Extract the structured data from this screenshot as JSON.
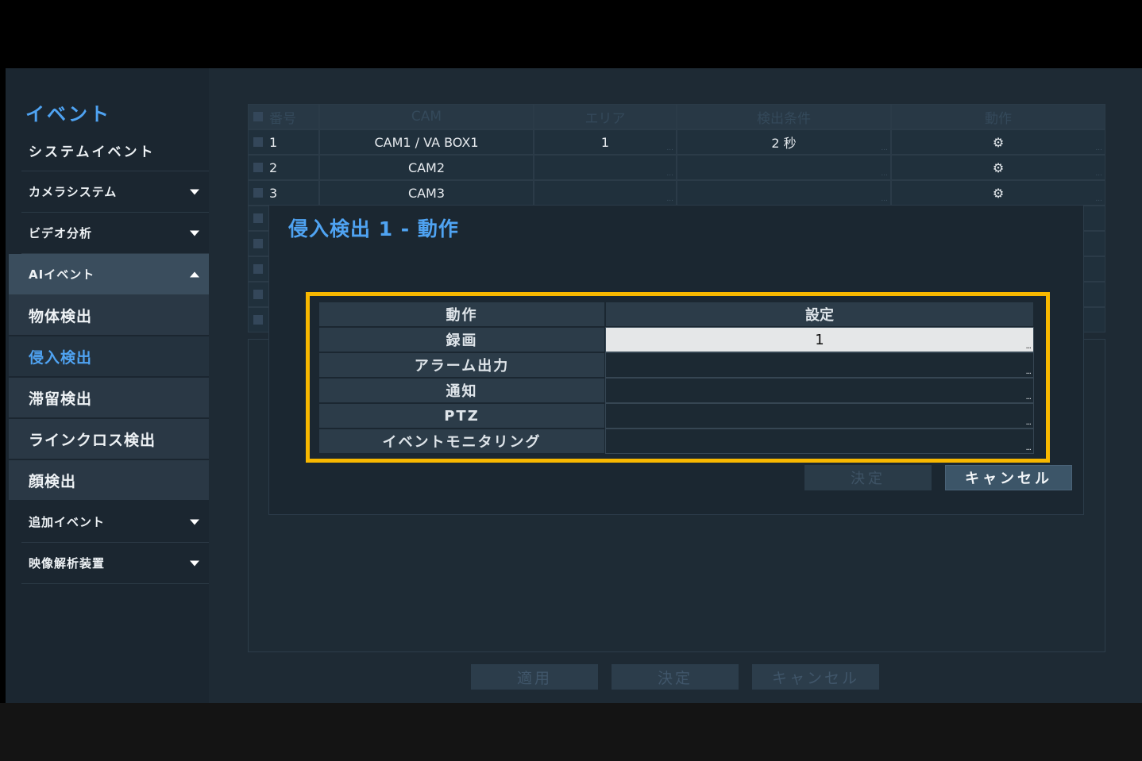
{
  "sidebar": {
    "title": "イベント",
    "items": [
      {
        "label": "システムイベント"
      },
      {
        "label": "カメラシステム"
      },
      {
        "label": "ビデオ分析"
      },
      {
        "label": "AIイベント"
      },
      {
        "label": "物体検出"
      },
      {
        "label": "侵入検出"
      },
      {
        "label": "滞留検出"
      },
      {
        "label": "ラインクロス検出"
      },
      {
        "label": "顔検出"
      },
      {
        "label": "追加イベント"
      },
      {
        "label": "映像解析装置"
      }
    ]
  },
  "background_table": {
    "headers": [
      "番号",
      "CAM",
      "エリア",
      "検出条件",
      "動作"
    ],
    "rows": [
      {
        "no": "1",
        "cam": "CAM1 / VA BOX1",
        "area": "1",
        "condition": "2 秒"
      },
      {
        "no": "2",
        "cam": "CAM2",
        "area": "",
        "condition": ""
      },
      {
        "no": "3",
        "cam": "CAM3",
        "area": "",
        "condition": ""
      }
    ]
  },
  "footer_buttons": {
    "apply": "適用",
    "ok": "決定",
    "cancel": "キャンセル"
  },
  "dialog": {
    "title": "侵入検出 1 - 動作",
    "header": {
      "action": "動作",
      "setting": "設定"
    },
    "rows": [
      {
        "label": "録画",
        "value": "1"
      },
      {
        "label": "アラーム出力",
        "value": ""
      },
      {
        "label": "通知",
        "value": ""
      },
      {
        "label": "PTZ",
        "value": ""
      },
      {
        "label": "イベントモニタリング",
        "value": ""
      }
    ],
    "more_glyph": "...",
    "ok": "決定",
    "cancel": "キャンセル"
  },
  "colors": {
    "accent": "#4fa3f2",
    "highlight_frame": "#f8b800",
    "background": "#1e2a34"
  }
}
